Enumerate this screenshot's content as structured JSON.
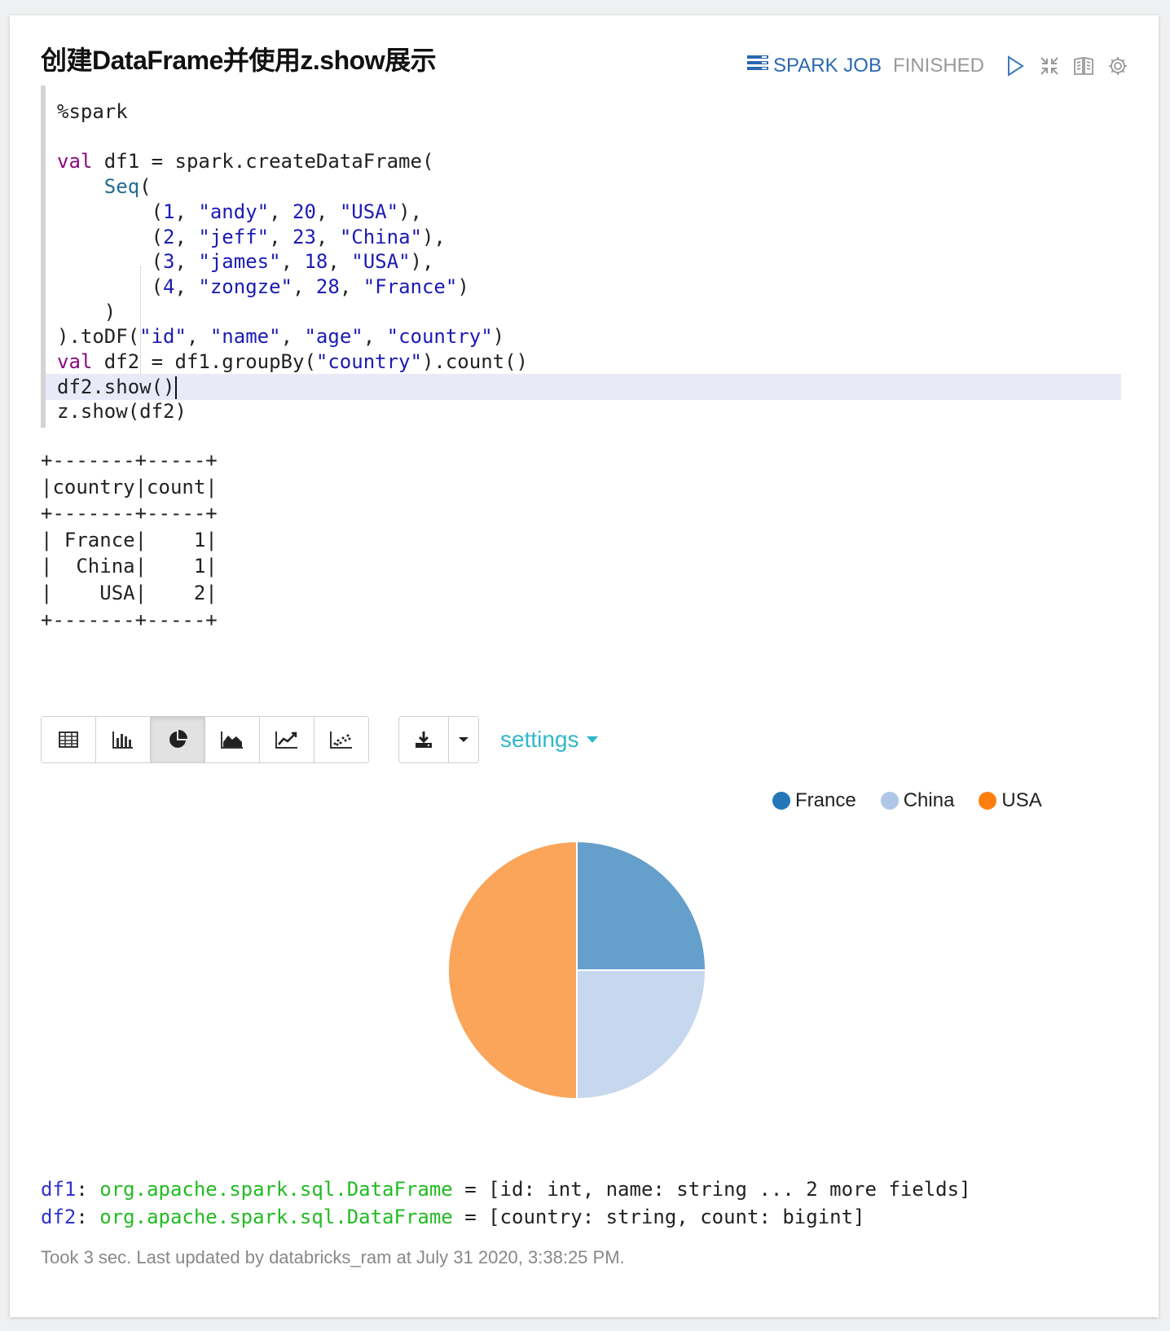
{
  "paragraph": {
    "title": "创建DataFrame并使用z.show展示",
    "job_label": "SPARK JOB",
    "status": "FINISHED"
  },
  "code": {
    "lines": [
      "%spark",
      "",
      "val df1 = spark.createDataFrame(",
      "    Seq(",
      "        (1, \"andy\", 20, \"USA\"),",
      "        (2, \"jeff\", 23, \"China\"),",
      "        (3, \"james\", 18, \"USA\"),",
      "        (4, \"zongze\", 28, \"France\")",
      "    )",
      ").toDF(\"id\", \"name\", \"age\", \"country\")",
      "val df2 = df1.groupBy(\"country\").count()",
      "df2.show()",
      "z.show(df2)"
    ],
    "active_line": 11
  },
  "text_output": "+-------+-----+\n|country|count|\n+-------+-----+\n| France|    1|\n|  China|    1|\n|    USA|    2|\n+-------+-----+",
  "viz": {
    "active_mode": "pie",
    "modes": [
      "table-icon",
      "bar-chart-icon",
      "pie-chart-icon",
      "area-chart-icon",
      "line-chart-icon",
      "scatter-chart-icon"
    ],
    "settings_label": "settings"
  },
  "chart_data": {
    "type": "pie",
    "categories": [
      "France",
      "China",
      "USA"
    ],
    "values": [
      1,
      1,
      2
    ],
    "colors": [
      "#659fcb",
      "#c6d7ee",
      "#faa55a"
    ],
    "legend_colors": [
      "#2376b7",
      "#aec7e8",
      "#ff7f0e"
    ],
    "legend": "top-right"
  },
  "repl": {
    "df1_name": "df1",
    "df1_type": "org.apache.spark.sql.DataFrame",
    "df1_schema": "[id: int, name: string ... 2 more fields]",
    "df2_name": "df2",
    "df2_type": "org.apache.spark.sql.DataFrame",
    "df2_schema": "[country: string, count: bigint]"
  },
  "footer": "Took 3 sec. Last updated by databricks_ram at July 31 2020, 3:38:25 PM."
}
